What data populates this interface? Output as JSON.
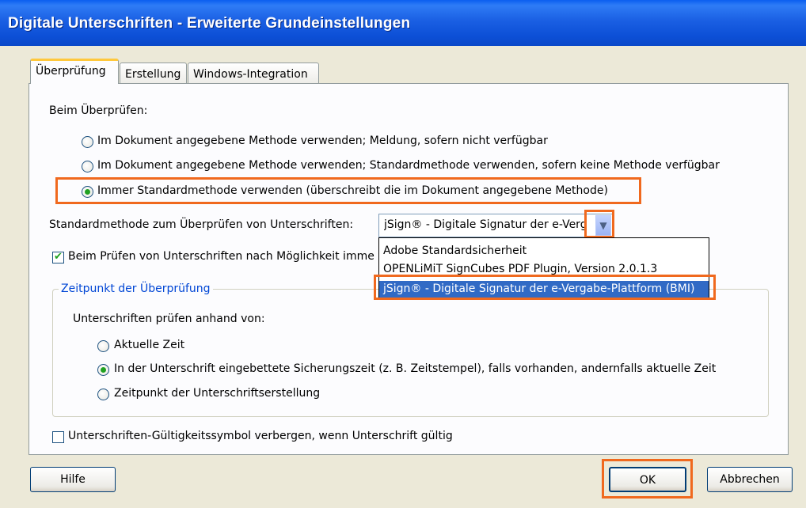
{
  "window": {
    "title": "Digitale Unterschriften - Erweiterte Grundeinstellungen"
  },
  "tabs": [
    {
      "label": "Überprüfung",
      "active": true
    },
    {
      "label": "Erstellung",
      "active": false
    },
    {
      "label": "Windows-Integration",
      "active": false
    }
  ],
  "verify": {
    "heading": "Beim Überprüfen:",
    "options": [
      {
        "label": "Im Dokument angegebene Methode verwenden; Meldung, sofern nicht verfügbar",
        "selected": false
      },
      {
        "label": "Im Dokument angegebene Methode verwenden; Standardmethode verwenden, sofern keine Methode verfügbar",
        "selected": false
      },
      {
        "label": "Immer Standardmethode verwenden (überschreibt die im Dokument angegebene Methode)",
        "selected": true
      }
    ]
  },
  "default_method": {
    "label": "Standardmethode zum Überprüfen von Unterschriften:",
    "value": "jSign® - Digitale Signatur der e-Vergabe-Plattform (BMI)",
    "options": [
      "Adobe Standardsicherheit",
      "OPENLiMiT SignCubes PDF Plugin, Version 2.0.1.3",
      "jSign® - Digitale Signatur der e-Vergabe-Plattform (BMI)"
    ],
    "selected_index": 2
  },
  "check_certs": {
    "label": "Beim Prüfen von Unterschriften nach Möglichkeit imme",
    "checked": true
  },
  "time_group": {
    "title": "Zeitpunkt der Überprüfung",
    "heading": "Unterschriften prüfen anhand von:",
    "options": [
      {
        "label": "Aktuelle Zeit",
        "selected": false
      },
      {
        "label": "In der Unterschrift eingebettete Sicherungszeit (z. B. Zeitstempel), falls vorhanden, andernfalls aktuelle Zeit",
        "selected": true
      },
      {
        "label": "Zeitpunkt der Unterschriftserstellung",
        "selected": false
      }
    ]
  },
  "hide_icon": {
    "label": "Unterschriften-Gültigkeitssymbol verbergen, wenn Unterschrift gültig",
    "checked": false
  },
  "buttons": {
    "help": "Hilfe",
    "ok": "OK",
    "cancel": "Abbrechen"
  },
  "colors": {
    "highlight": "#f0691e",
    "title_bar": "#0c4fd6",
    "selection": "#316ac5"
  }
}
